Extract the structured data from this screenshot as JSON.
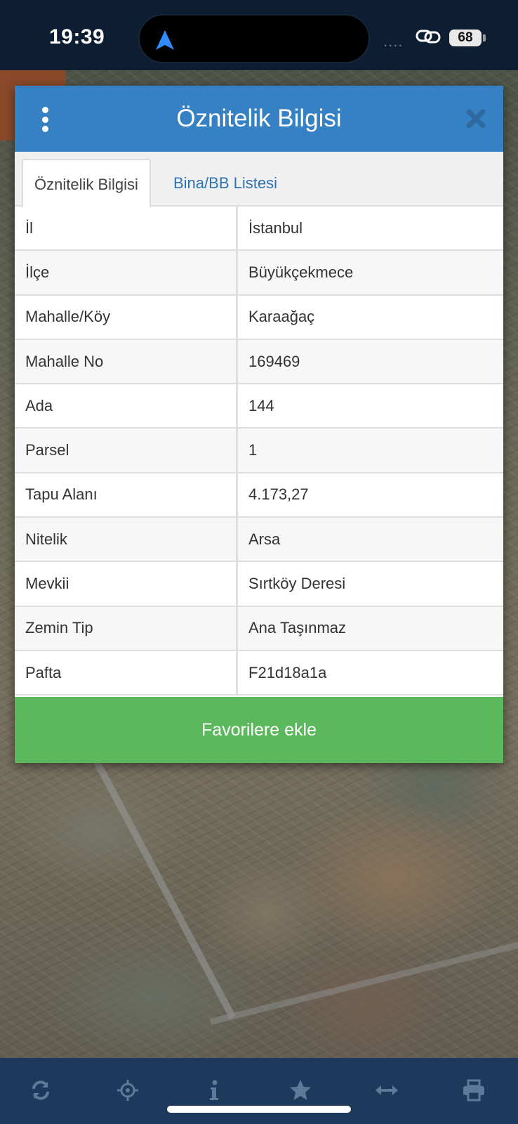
{
  "status_bar": {
    "time": "19:39",
    "signal": "....",
    "battery": "68"
  },
  "dialog": {
    "title": "Öznitelik Bilgisi",
    "tabs": [
      {
        "label": "Öznitelik Bilgisi",
        "active": true
      },
      {
        "label": "Bina/BB Listesi",
        "active": false
      }
    ],
    "rows": [
      {
        "key": "İl",
        "value": "İstanbul"
      },
      {
        "key": "İlçe",
        "value": "Büyükçekmece"
      },
      {
        "key": "Mahalle/Köy",
        "value": "Karaağaç"
      },
      {
        "key": "Mahalle No",
        "value": "169469"
      },
      {
        "key": "Ada",
        "value": "144"
      },
      {
        "key": "Parsel",
        "value": "1"
      },
      {
        "key": "Tapu Alanı",
        "value": "4.173,27"
      },
      {
        "key": "Nitelik",
        "value": "Arsa"
      },
      {
        "key": "Mevkii",
        "value": "Sırtköy Deresi"
      },
      {
        "key": "Zemin Tip",
        "value": "Ana Taşınmaz"
      },
      {
        "key": "Pafta",
        "value": "F21d18a1a"
      }
    ],
    "favorite_button": "Favorilere ekle"
  },
  "toolbar": {
    "icons": [
      "refresh-icon",
      "locate-icon",
      "info-icon",
      "star-icon",
      "measure-icon",
      "print-icon"
    ]
  },
  "colors": {
    "header": "#3581c4",
    "favorite": "#5cb85c",
    "toolbar": "#1d3a5c",
    "tab_link": "#2f73b5"
  }
}
